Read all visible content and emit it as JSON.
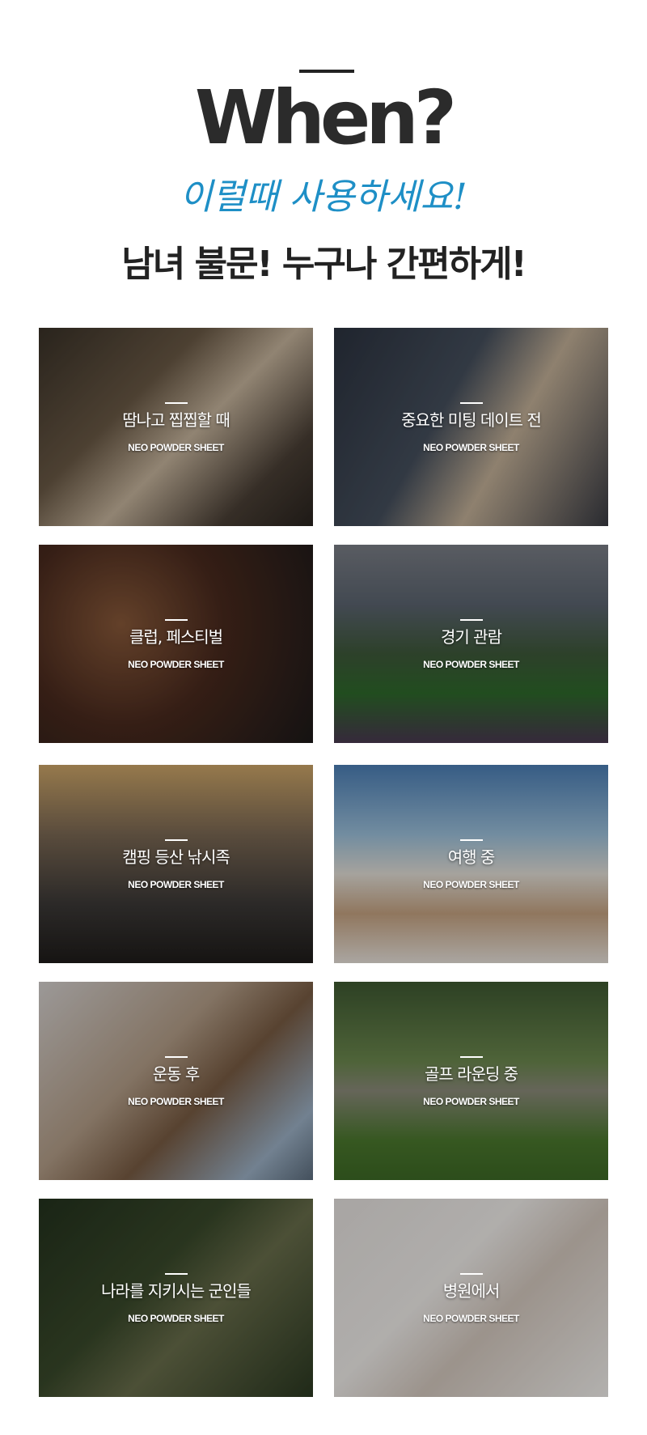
{
  "header": {
    "title": "When?",
    "script_text": "이럴때 사용하세요!",
    "subtitle": "남녀 불문! 누구나 간편하게!"
  },
  "tiles": [
    {
      "label": "땀나고 찝찝할 때",
      "brand": "NEO POWDER SHEET"
    },
    {
      "label": "중요한 미팅 데이트 전",
      "brand": "NEO POWDER SHEET"
    },
    {
      "label": "클럽, 페스티벌",
      "brand": "NEO POWDER SHEET"
    },
    {
      "label": "경기 관람",
      "brand": "NEO POWDER SHEET"
    },
    {
      "label": "캠핑 등산 낚시족",
      "brand": "NEO POWDER SHEET"
    },
    {
      "label": "여행 중",
      "brand": "NEO POWDER SHEET"
    },
    {
      "label": "운동 후",
      "brand": "NEO POWDER SHEET"
    },
    {
      "label": "골프 라운딩 중",
      "brand": "NEO POWDER SHEET"
    },
    {
      "label": "나라를 지키시는 군인들",
      "brand": "NEO POWDER SHEET"
    },
    {
      "label": "병원에서",
      "brand": "NEO POWDER SHEET"
    }
  ],
  "colors": {
    "title": "#2b2b2b",
    "script": "#1e8fc6",
    "subtitle": "#222222"
  }
}
